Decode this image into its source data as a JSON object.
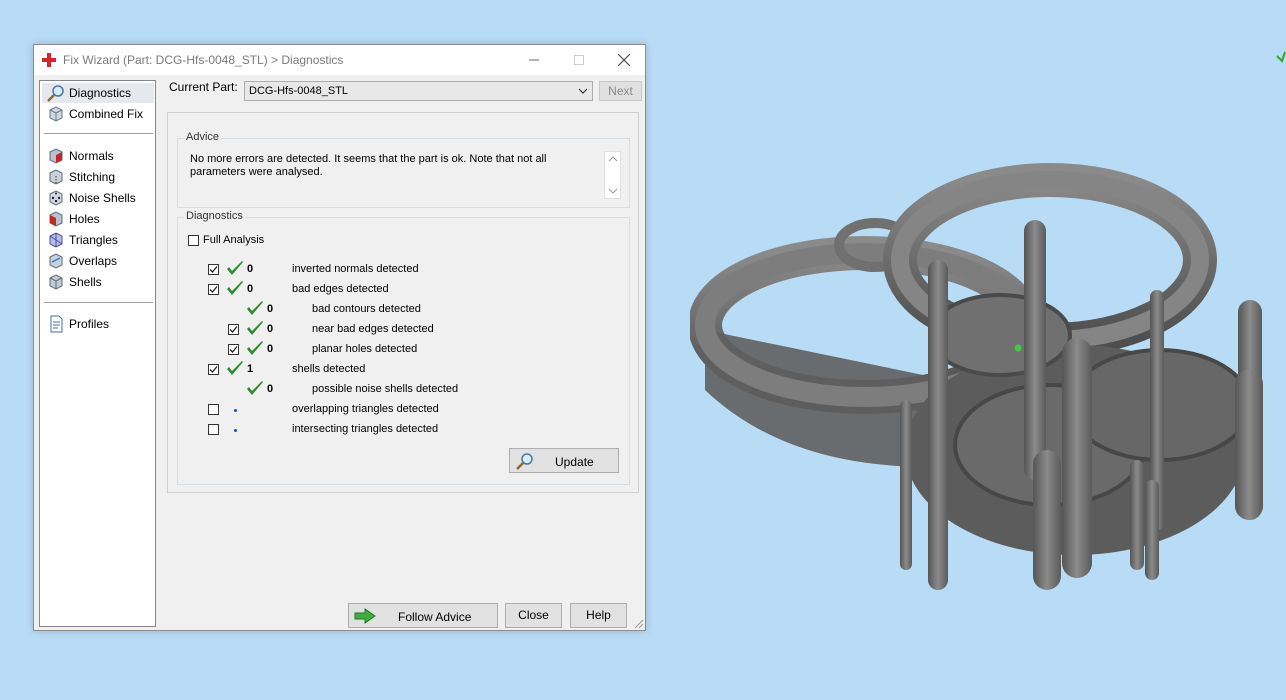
{
  "window": {
    "title": "Fix Wizard (Part: DCG-Hfs-0048_STL) > Diagnostics",
    "app_icon": "red-cross-icon",
    "controls": [
      "minimize-icon",
      "maximize-icon",
      "close-icon"
    ]
  },
  "nav": {
    "items": [
      {
        "label": "Diagnostics",
        "icon": "magnifier-icon",
        "selected": true
      },
      {
        "label": "Combined Fix",
        "icon": "cube-icon"
      },
      {
        "label": "Normals",
        "icon": "normals-cube-icon"
      },
      {
        "label": "Stitching",
        "icon": "stitching-cube-icon"
      },
      {
        "label": "Noise Shells",
        "icon": "dice-icon"
      },
      {
        "label": "Holes",
        "icon": "holes-cube-icon"
      },
      {
        "label": "Triangles",
        "icon": "triangles-cube-icon"
      },
      {
        "label": "Overlaps",
        "icon": "overlaps-cube-icon"
      },
      {
        "label": "Shells",
        "icon": "shells-cube-icon"
      },
      {
        "label": "Profiles",
        "icon": "document-icon"
      }
    ]
  },
  "current_part": {
    "label": "Current Part:",
    "value": "DCG-Hfs-0048_STL",
    "next_label": "Next"
  },
  "advice": {
    "title": "Advice",
    "text": "No more errors are detected. It seems that the part is ok. Note that not all parameters were analysed."
  },
  "diagnostics": {
    "title": "Diagnostics",
    "full_analysis_label": "Full Analysis",
    "full_analysis_checked": false,
    "rows": [
      {
        "checkbox": true,
        "checked": true,
        "status": "ok",
        "count": "0",
        "label": "inverted normals detected",
        "indent": 0
      },
      {
        "checkbox": true,
        "checked": true,
        "status": "ok",
        "count": "0",
        "label": "bad edges detected",
        "indent": 0
      },
      {
        "checkbox": false,
        "checked": false,
        "status": "ok",
        "count": "0",
        "label": "bad contours detected",
        "indent": 1
      },
      {
        "checkbox": true,
        "checked": true,
        "status": "ok",
        "count": "0",
        "label": "near bad edges detected",
        "indent": 1
      },
      {
        "checkbox": true,
        "checked": true,
        "status": "ok",
        "count": "0",
        "label": "planar holes detected",
        "indent": 1
      },
      {
        "checkbox": true,
        "checked": true,
        "status": "ok",
        "count": "1",
        "label": "shells detected",
        "indent": 0
      },
      {
        "checkbox": false,
        "checked": false,
        "status": "ok",
        "count": "0",
        "label": "possible noise shells detected",
        "indent": 1
      },
      {
        "checkbox": true,
        "checked": false,
        "status": "pending",
        "count": "",
        "label": "overlapping triangles detected",
        "indent": 0
      },
      {
        "checkbox": true,
        "checked": false,
        "status": "pending",
        "count": "",
        "label": "intersecting triangles detected",
        "indent": 0
      }
    ],
    "update_label": "Update"
  },
  "buttons": {
    "follow_advice": "Follow Advice",
    "close": "Close",
    "help": "Help"
  },
  "colors": {
    "viewport_bg": "#b9dcf6",
    "check_green": "#2e8b2e",
    "model_gray": "#6e6e6e",
    "pending_dot": "#1f4fb3"
  }
}
